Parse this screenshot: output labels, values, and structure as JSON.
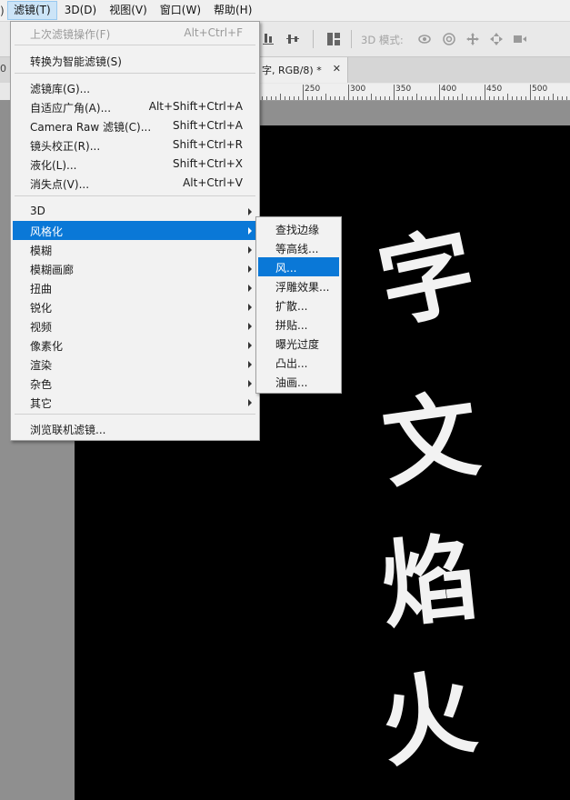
{
  "menubar": {
    "items": [
      {
        "label": "滤镜(T)",
        "active": true
      },
      {
        "label": "3D(D)"
      },
      {
        "label": "视图(V)"
      },
      {
        "label": "窗口(W)"
      },
      {
        "label": "帮助(H)"
      }
    ]
  },
  "options_bar": {
    "mode3d_label": "3D 模式:"
  },
  "tabs": {
    "left_fragment": "0",
    "doc_title": "字, RGB/8) *",
    "close_glyph": "✕"
  },
  "ruler": {
    "labels": [
      "250",
      "300",
      "350",
      "400",
      "450",
      "500"
    ]
  },
  "filter_menu": {
    "items": [
      {
        "label": "上次滤镜操作(F)",
        "shortcut": "Alt+Ctrl+F",
        "disabled": true
      },
      {
        "label": "转换为智能滤镜(S)"
      },
      {
        "label": "滤镜库(G)..."
      },
      {
        "label": "自适应广角(A)...",
        "shortcut": "Alt+Shift+Ctrl+A"
      },
      {
        "label": "Camera Raw 滤镜(C)...",
        "shortcut": "Shift+Ctrl+A"
      },
      {
        "label": "镜头校正(R)...",
        "shortcut": "Shift+Ctrl+R"
      },
      {
        "label": "液化(L)...",
        "shortcut": "Shift+Ctrl+X"
      },
      {
        "label": "消失点(V)...",
        "shortcut": "Alt+Ctrl+V"
      },
      {
        "label": "3D",
        "submenu": true
      },
      {
        "label": "风格化",
        "submenu": true,
        "highlight": true
      },
      {
        "label": "模糊",
        "submenu": true
      },
      {
        "label": "模糊画廊",
        "submenu": true
      },
      {
        "label": "扭曲",
        "submenu": true
      },
      {
        "label": "锐化",
        "submenu": true
      },
      {
        "label": "视频",
        "submenu": true
      },
      {
        "label": "像素化",
        "submenu": true
      },
      {
        "label": "渲染",
        "submenu": true
      },
      {
        "label": "杂色",
        "submenu": true
      },
      {
        "label": "其它",
        "submenu": true
      },
      {
        "label": "浏览联机滤镜..."
      }
    ]
  },
  "stylize_submenu": {
    "items": [
      {
        "label": "查找边缘"
      },
      {
        "label": "等高线..."
      },
      {
        "label": "风...",
        "highlight": true
      },
      {
        "label": "浮雕效果..."
      },
      {
        "label": "扩散..."
      },
      {
        "label": "拼贴..."
      },
      {
        "label": "曝光过度"
      },
      {
        "label": "凸出..."
      },
      {
        "label": "油画..."
      }
    ]
  },
  "canvas": {
    "characters": [
      "字",
      "文",
      "焰",
      "火"
    ]
  },
  "colors": {
    "highlight": "#0a78d7",
    "menu_bg": "#f2f2f2",
    "canvas_bg": "#000000",
    "workspace": "#8f8f8f"
  },
  "icons": [
    "align-icon",
    "distribute-icon",
    "rotate-3d-icon",
    "roll-3d-icon",
    "drag-3d-icon",
    "slide-3d-icon",
    "scale-3d-icon"
  ]
}
